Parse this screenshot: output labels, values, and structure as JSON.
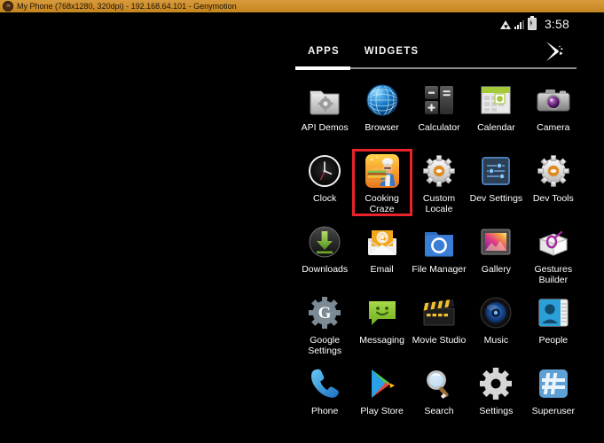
{
  "window": {
    "title": "My Phone (768x1280, 320dpi) - 192.168.64.101 - Genymotion",
    "logo_icon": "genymotion-icon"
  },
  "statusbar": {
    "wifi_icon": "wifi-icon",
    "signal_icon": "signal-icon",
    "battery_icon": "battery-charging-icon",
    "time": "3:58"
  },
  "tabbar": {
    "tabs": [
      {
        "label": "APPS",
        "selected": true
      },
      {
        "label": "WIDGETS",
        "selected": false
      }
    ],
    "playstore_icon": "play-store-icon"
  },
  "apps": [
    {
      "label": "API Demos",
      "icon": "api-demos-icon",
      "selected": false
    },
    {
      "label": "Browser",
      "icon": "browser-icon",
      "selected": false
    },
    {
      "label": "Calculator",
      "icon": "calculator-icon",
      "selected": false
    },
    {
      "label": "Calendar",
      "icon": "calendar-icon",
      "selected": false
    },
    {
      "label": "Camera",
      "icon": "camera-icon",
      "selected": false
    },
    {
      "label": "Clock",
      "icon": "clock-icon",
      "selected": false
    },
    {
      "label": "Cooking Craze",
      "icon": "cooking-craze-icon",
      "selected": true
    },
    {
      "label": "Custom Locale",
      "icon": "custom-locale-icon",
      "selected": false
    },
    {
      "label": "Dev Settings",
      "icon": "dev-settings-icon",
      "selected": false
    },
    {
      "label": "Dev Tools",
      "icon": "dev-tools-icon",
      "selected": false
    },
    {
      "label": "Downloads",
      "icon": "downloads-icon",
      "selected": false
    },
    {
      "label": "Email",
      "icon": "email-icon",
      "selected": false
    },
    {
      "label": "File Manager",
      "icon": "file-manager-icon",
      "selected": false
    },
    {
      "label": "Gallery",
      "icon": "gallery-icon",
      "selected": false
    },
    {
      "label": "Gestures Builder",
      "icon": "gestures-builder-icon",
      "selected": false
    },
    {
      "label": "Google Settings",
      "icon": "google-settings-icon",
      "selected": false
    },
    {
      "label": "Messaging",
      "icon": "messaging-icon",
      "selected": false
    },
    {
      "label": "Movie Studio",
      "icon": "movie-studio-icon",
      "selected": false
    },
    {
      "label": "Music",
      "icon": "music-icon",
      "selected": false
    },
    {
      "label": "People",
      "icon": "people-icon",
      "selected": false
    },
    {
      "label": "Phone",
      "icon": "phone-icon",
      "selected": false
    },
    {
      "label": "Play Store",
      "icon": "play-store-icon",
      "selected": false
    },
    {
      "label": "Search",
      "icon": "search-icon",
      "selected": false
    },
    {
      "label": "Settings",
      "icon": "settings-icon",
      "selected": false
    },
    {
      "label": "Superuser",
      "icon": "superuser-icon",
      "selected": false
    }
  ],
  "colors": {
    "titlebar": "#cf8f2c",
    "screen_bg": "#000000",
    "selection": "#e8242a",
    "tab_active": "#ffffff",
    "tab_line": "#8f8f8f"
  }
}
